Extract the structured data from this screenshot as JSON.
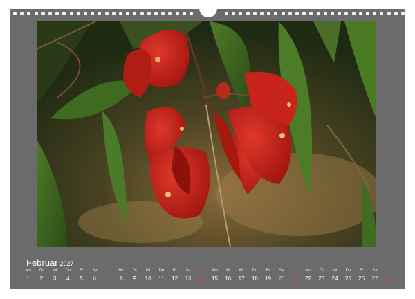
{
  "calendar": {
    "month": "Februar",
    "year": "2027",
    "days": [
      {
        "dow": "Mo",
        "num": "1"
      },
      {
        "dow": "Di",
        "num": "2"
      },
      {
        "dow": "Mi",
        "num": "3"
      },
      {
        "dow": "Do",
        "num": "4"
      },
      {
        "dow": "Fr",
        "num": "5"
      },
      {
        "dow": "Sa",
        "num": "6"
      },
      {
        "dow": "So",
        "num": "7"
      },
      {
        "dow": "Mo",
        "num": "8"
      },
      {
        "dow": "Di",
        "num": "9"
      },
      {
        "dow": "Mi",
        "num": "10"
      },
      {
        "dow": "Do",
        "num": "11"
      },
      {
        "dow": "Fr",
        "num": "12"
      },
      {
        "dow": "Sa",
        "num": "13"
      },
      {
        "dow": "So",
        "num": "14"
      },
      {
        "dow": "Mo",
        "num": "15"
      },
      {
        "dow": "Di",
        "num": "16"
      },
      {
        "dow": "Mi",
        "num": "17"
      },
      {
        "dow": "Do",
        "num": "18"
      },
      {
        "dow": "Fr",
        "num": "19"
      },
      {
        "dow": "Sa",
        "num": "20"
      },
      {
        "dow": "So",
        "num": "21"
      },
      {
        "dow": "Mo",
        "num": "22"
      },
      {
        "dow": "Di",
        "num": "23"
      },
      {
        "dow": "Mi",
        "num": "24"
      },
      {
        "dow": "Do",
        "num": "25"
      },
      {
        "dow": "Fr",
        "num": "26"
      },
      {
        "dow": "Sa",
        "num": "27"
      },
      {
        "dow": "So",
        "num": "28"
      }
    ]
  },
  "colors": {
    "page_background": "#6b6b6b",
    "text": "#ffffff",
    "sunday": "#d04040",
    "flower_red": "#c0201a"
  },
  "photo": {
    "subject": "red-coral-tree-flowers"
  }
}
